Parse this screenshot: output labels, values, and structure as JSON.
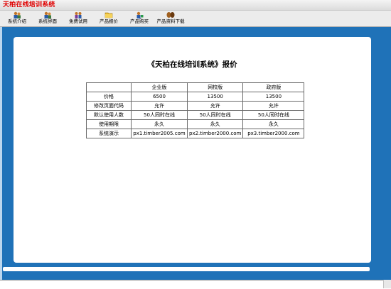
{
  "window": {
    "title": "天柏在线培训系统"
  },
  "toolbar": {
    "items": [
      {
        "label": "系统介绍",
        "icon": "people-icon"
      },
      {
        "label": "系统界面",
        "icon": "people-icon"
      },
      {
        "label": "免费试用",
        "icon": "users-icon"
      },
      {
        "label": "产品报价",
        "icon": "folder-icon"
      },
      {
        "label": "产品购买",
        "icon": "buyer-icon"
      },
      {
        "label": "产品资料下载",
        "icon": "download-icon"
      }
    ]
  },
  "main": {
    "heading": "《天柏在线培训系统》报价",
    "table": {
      "headers": [
        "",
        "企业版",
        "网校版",
        "政府版"
      ],
      "rows": [
        [
          "价格",
          "6500",
          "13500",
          "13500"
        ],
        [
          "修改页面代码",
          "允许",
          "允许",
          "允许"
        ],
        [
          "默认使用人数",
          "50人同时在线",
          "50人同时在线",
          "50人同时在线"
        ],
        [
          "使用期限",
          "永久",
          "永久",
          "永久"
        ],
        [
          "系统演示",
          "px1.timber2005.com",
          "px2.timber2000.com",
          "px3.timber2000.com"
        ]
      ]
    }
  },
  "colors": {
    "frame": "#1f72b8",
    "title": "#e00000"
  }
}
